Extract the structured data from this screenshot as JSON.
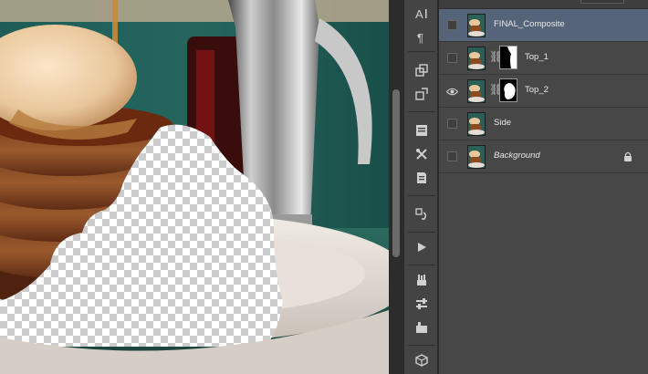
{
  "canvas": {
    "image": "pancake-stack-photo-with-transparent-area"
  },
  "tools": {
    "icons": [
      "character-icon",
      "paragraph-icon",
      "clone-source-icon",
      "brush-preset-icon",
      "notes-icon",
      "tool-presets-icon",
      "properties-icon",
      "history-icon",
      "actions-play-icon",
      "brushes-icon",
      "adjustments-icon",
      "styles-icon",
      "3d-icon"
    ]
  },
  "layers": {
    "rows": [
      {
        "name": "FINAL_Composite",
        "visible": false,
        "selected": true,
        "has_mask": false,
        "locked": false
      },
      {
        "name": "Top_1",
        "visible": false,
        "selected": false,
        "has_mask": true,
        "locked": false
      },
      {
        "name": "Top_2",
        "visible": true,
        "selected": false,
        "has_mask": true,
        "locked": false
      },
      {
        "name": "Side",
        "visible": false,
        "selected": false,
        "has_mask": false,
        "locked": false
      },
      {
        "name": "Background",
        "visible": false,
        "selected": false,
        "has_mask": false,
        "locked": true
      }
    ]
  },
  "colors": {
    "selected_row": "#56647a",
    "panel_bg": "#474747"
  }
}
